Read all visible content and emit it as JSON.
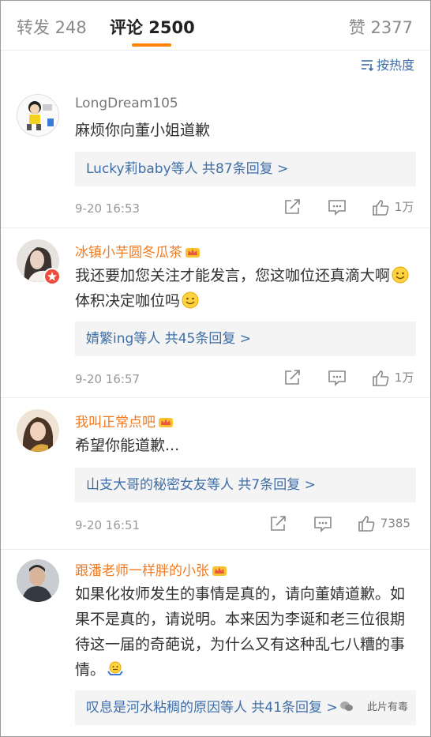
{
  "tabs": {
    "repost": "转发 248",
    "comment": "评论 2500",
    "like": "赞 2377"
  },
  "sort_label": "按热度",
  "comments": [
    {
      "user": "LongDream105",
      "text": "麻烦你向董小姐道歉",
      "replies": "Lucky莉baby等人  共87条回复 >",
      "time": "9-20 16:53",
      "likes": "1万"
    },
    {
      "user": "冰镇小芋圆冬瓜茶",
      "text_a": "我还要加您关注才能发言，您这咖位还真滴大啊",
      "text_b": "体积决定咖位吗",
      "replies": "婧繁ing等人  共45条回复 >",
      "time": "9-20 16:57",
      "likes": "1万"
    },
    {
      "user": "我叫正常点吧",
      "text": "希望你能道歉...",
      "replies": "山支大哥的秘密女友等人  共7条回复 >",
      "time": "9-20 16:51",
      "likes": "7385"
    },
    {
      "user": "跟潘老师一样胖的小张",
      "text": "如果化妆师发生的事情是真的，请向董婧道歉。如果不是真的，请说明。本来因为李诞和老三位很期待这一届的奇葩说，为什么又有这种乱七八糟的事情。",
      "replies": "叹息是河水粘稠的原因等人  共41条回复 >"
    }
  ],
  "watermark": "此片有毒",
  "colors": {
    "accent": "#ff8200",
    "link": "#3e6ea8",
    "vip_name": "#f37a1f"
  }
}
